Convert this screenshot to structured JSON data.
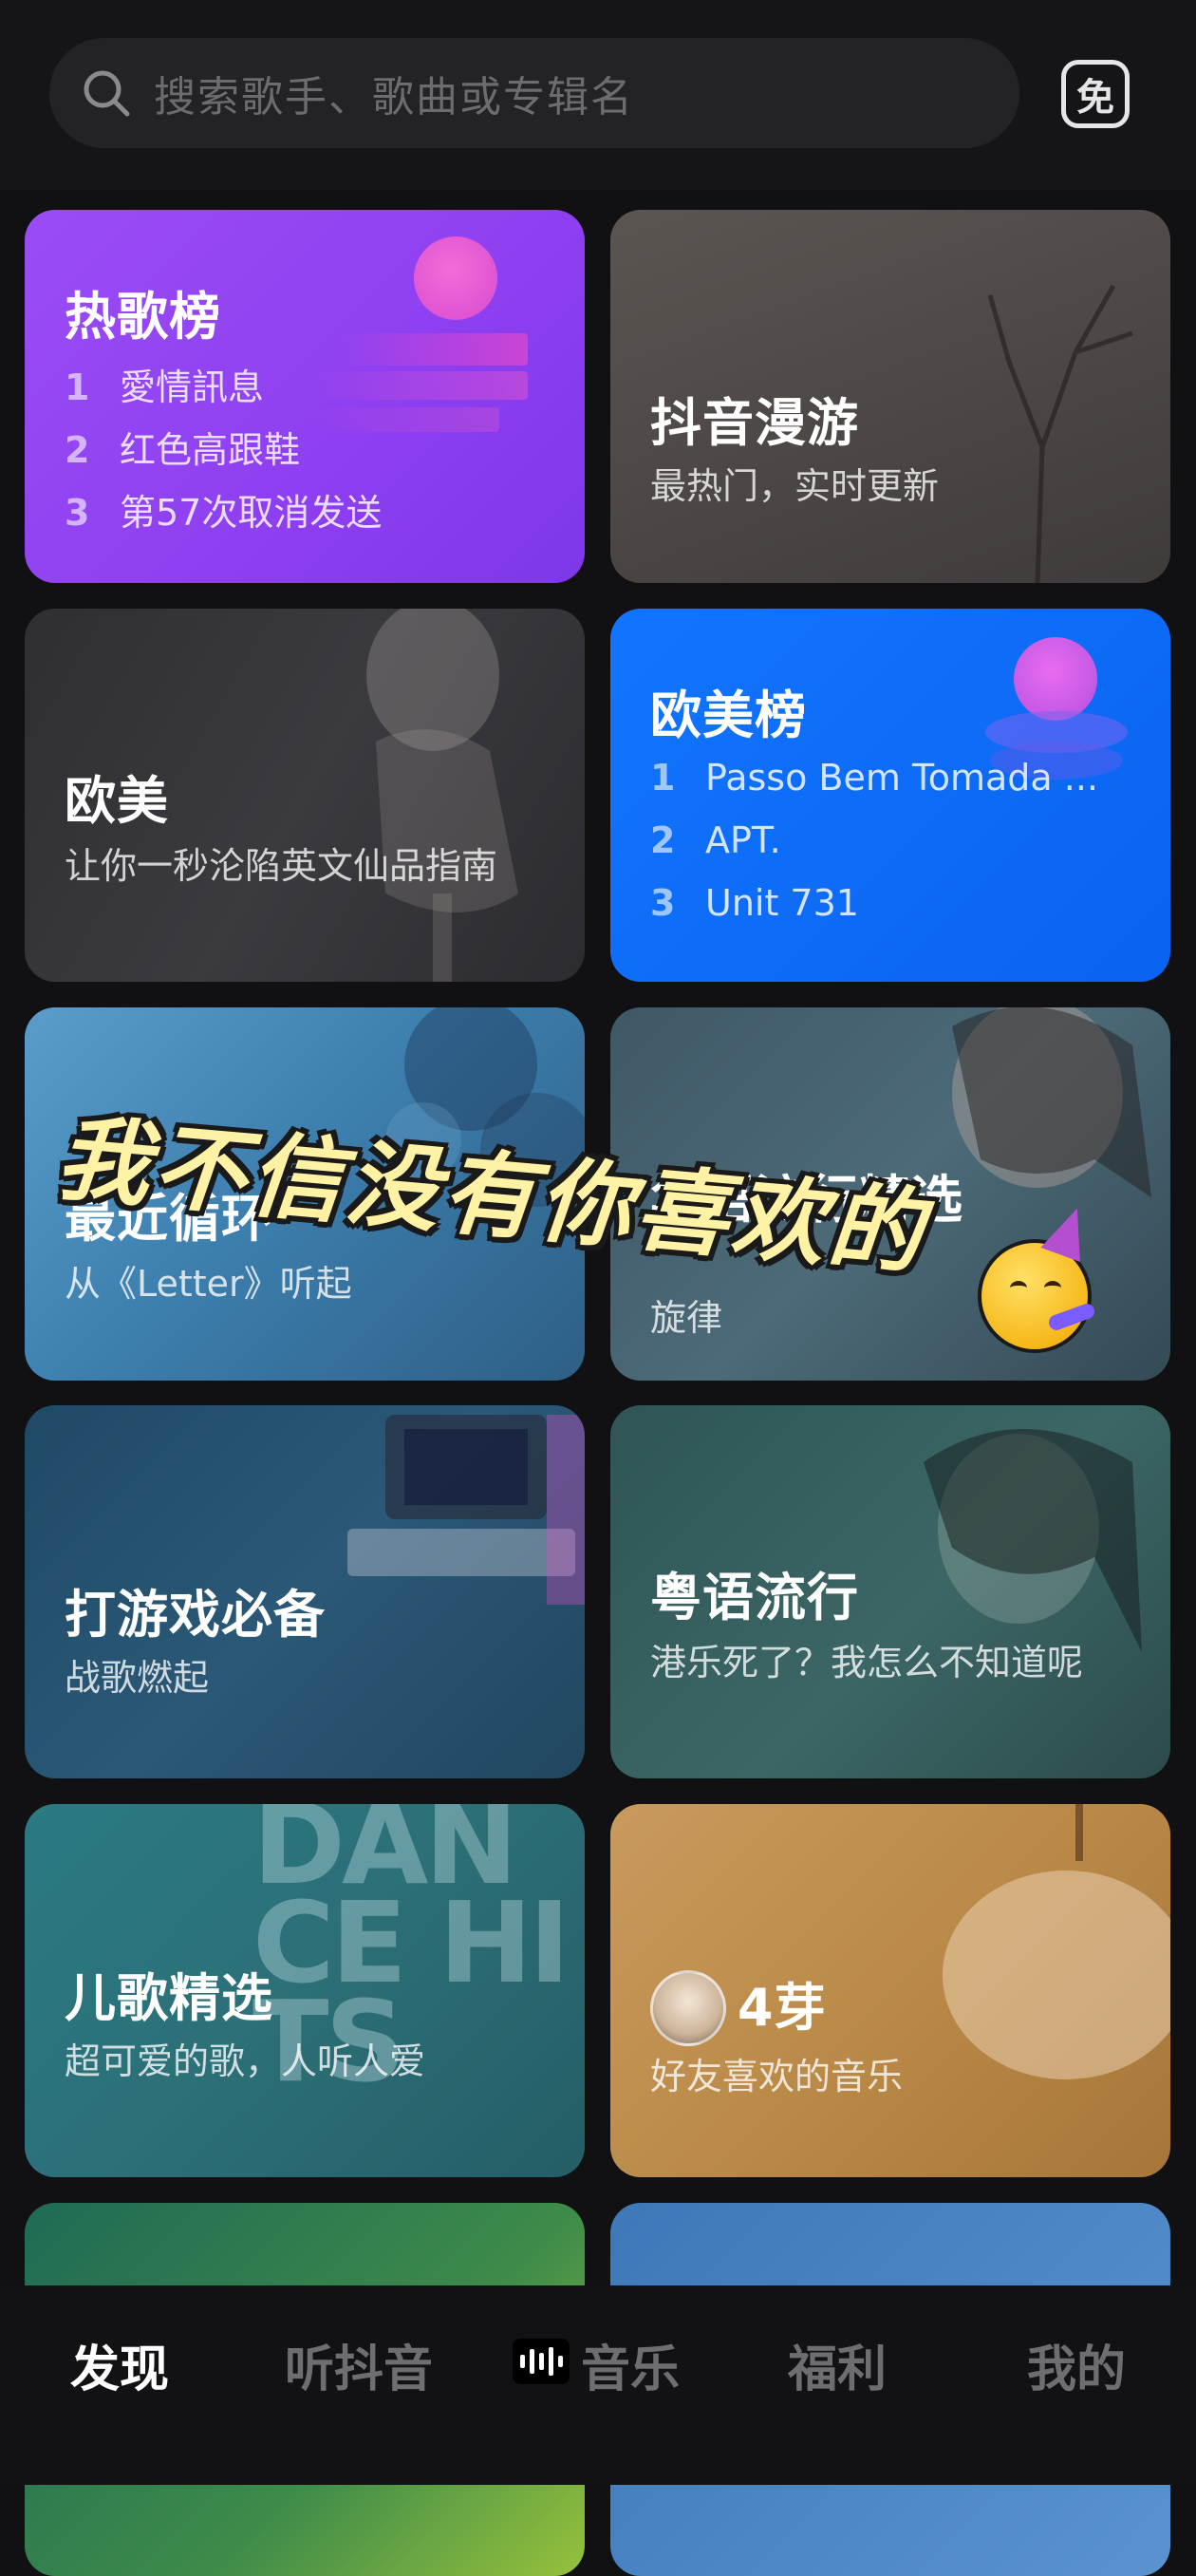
{
  "search": {
    "placeholder": "搜索歌手、歌曲或专辑名",
    "right_icon_label": "免"
  },
  "cards": {
    "hot": {
      "title": "热歌榜",
      "ranks": [
        {
          "n": "1",
          "t": "愛情訊息"
        },
        {
          "n": "2",
          "t": "红色高跟鞋"
        },
        {
          "n": "3",
          "t": "第57次取消发送"
        }
      ]
    },
    "douyin": {
      "title": "抖音漫游",
      "sub": "最热门，实时更新"
    },
    "oumei": {
      "title": "欧美",
      "sub": "让你一秒沦陷英文仙品指南"
    },
    "oumeibang": {
      "title": "欧美榜",
      "ranks": [
        {
          "n": "1",
          "t": "Passo Bem Tomada ..."
        },
        {
          "n": "2",
          "t": "APT."
        },
        {
          "n": "3",
          "t": "Unit 731"
        }
      ]
    },
    "recent": {
      "title": "最近循环",
      "sub": "从《Letter》听起"
    },
    "huayu": {
      "title": "华语流行精选",
      "sub": "旋律"
    },
    "game": {
      "title": "打游戏必备",
      "sub": "战歌燃起"
    },
    "yueyu": {
      "title": "粤语流行",
      "sub": "港乐死了？我怎么不知道呢"
    },
    "erge": {
      "title": "儿歌精选",
      "sub": "超可爱的歌，人听人爱",
      "bg_text": "DANCE HITS"
    },
    "friend": {
      "name": "4芽",
      "sub": "好友喜欢的音乐"
    }
  },
  "overlay": {
    "text": "我不信没有你喜欢的"
  },
  "nav": {
    "tabs": [
      "发现",
      "听抖音",
      "音乐",
      "福利",
      "我的"
    ],
    "active": "发现"
  }
}
